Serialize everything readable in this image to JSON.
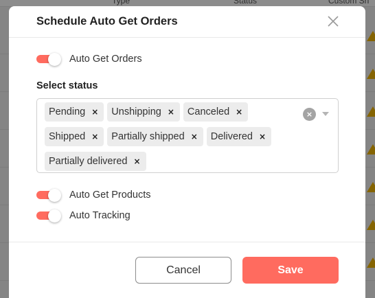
{
  "background": {
    "columns": [
      "Type",
      "Status",
      "Custom Sh"
    ]
  },
  "modal": {
    "title": "Schedule Auto Get Orders",
    "close_icon": "close-icon",
    "auto_get_orders": {
      "label": "Auto Get Orders",
      "enabled": true
    },
    "select_status": {
      "label": "Select status",
      "selected": [
        "Pending",
        "Unshipping",
        "Canceled",
        "Shipped",
        "Partially shipped",
        "Delivered",
        "Partially delivered"
      ],
      "remove_glyph": "×",
      "clear_glyph": "×"
    },
    "auto_get_products": {
      "label": "Auto Get Products",
      "enabled": true
    },
    "auto_tracking": {
      "label": "Auto Tracking",
      "enabled": true
    },
    "cancel_label": "Cancel",
    "save_label": "Save"
  },
  "colors": {
    "accent": "#ff6b5f",
    "warning": "#f2b705"
  }
}
